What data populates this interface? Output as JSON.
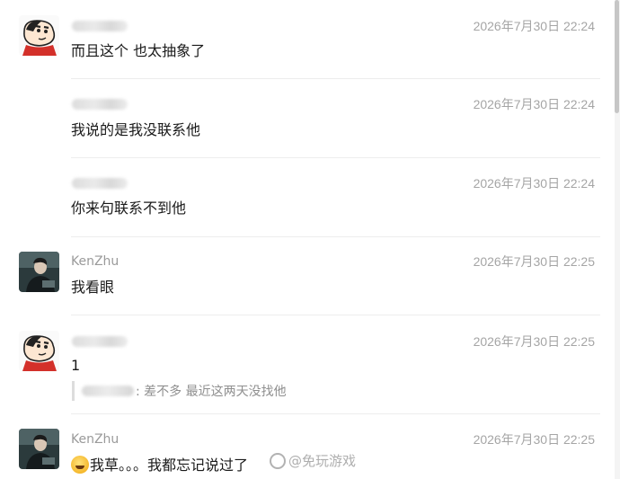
{
  "watermark": "@免玩游戏",
  "messages": [
    {
      "sender": "",
      "sender_hidden": true,
      "avatar": "crayon-shin-chan-avatar",
      "time": "2026年7月30日 22:24",
      "text": "而且这个 也太抽象了"
    },
    {
      "sender": "",
      "sender_hidden": true,
      "time": "2026年7月30日 22:24",
      "text": "我说的是我没联系他"
    },
    {
      "sender": "",
      "sender_hidden": true,
      "time": "2026年7月30日 22:24",
      "text": "你来句联系不到他"
    },
    {
      "sender": "KenZhu",
      "avatar": "dark-photo-avatar",
      "time": "2026年7月30日 22:25",
      "text": "我看眼"
    },
    {
      "sender": "",
      "sender_hidden": true,
      "avatar": "crayon-shin-chan-avatar",
      "time": "2026年7月30日 22:25",
      "text": "1",
      "quote": ": 差不多 最近这两天没找他"
    },
    {
      "sender": "KenZhu",
      "avatar": "dark-photo-avatar",
      "time": "2026年7月30日 22:25",
      "emoji": "laughing-emoji",
      "text": "我草。。。我都忘记说过了"
    }
  ]
}
